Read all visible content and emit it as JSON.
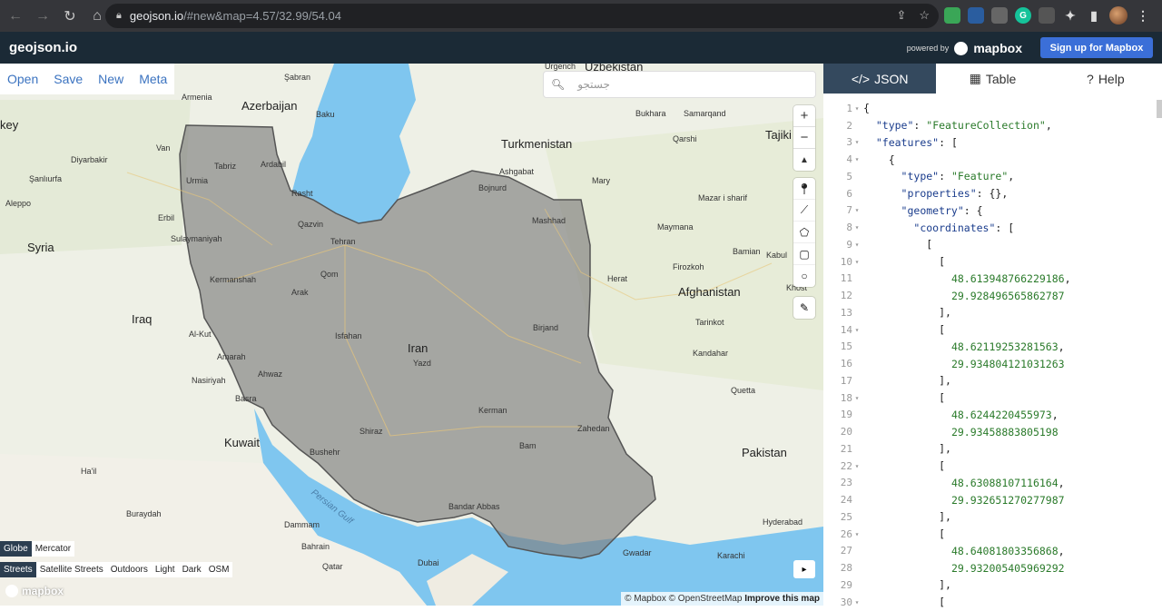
{
  "browser": {
    "url_host": "geojson.io",
    "url_path": "/#new&map=4.57/32.99/54.04"
  },
  "app": {
    "brand": "geojson.io",
    "powered_by": "powered by",
    "mapbox": "mapbox",
    "signup": "Sign up for Mapbox"
  },
  "menu": {
    "open": "Open",
    "save": "Save",
    "new": "New",
    "meta": "Meta"
  },
  "search": {
    "placeholder": "جستجو"
  },
  "map_labels": {
    "countries": [
      "Turkmenistan",
      "Afghanistan",
      "Iraq",
      "Syria",
      "Iran",
      "Pakistan",
      "Kuwait",
      "Uzbekistan",
      "Tajiki",
      "Azerbaijan"
    ],
    "cities": [
      "Şabran",
      "Baku",
      "Armenia",
      "key",
      "Van",
      "Diyarbakir",
      "Şanlıurfa",
      "Aleppo",
      "Erbil",
      "Sulaymaniyah",
      "Tabriz",
      "Ardabil",
      "Urmia",
      "Rasht",
      "Qazvin",
      "Tehran",
      "Qom",
      "Arak",
      "Kermanshah",
      "Isfahan",
      "Yazd",
      "Al-Kut",
      "Amarah",
      "Nasiriyah",
      "Ahwaz",
      "Basra",
      "Shiraz",
      "Kerman",
      "Bam",
      "Zahedan",
      "Bushehr",
      "Bandar Abbas",
      "Ha'il",
      "Buraydah",
      "Dammam",
      "Bahrain",
      "Qatar",
      "Dubai",
      "Gwadar",
      "Karachi",
      "Hyderabad",
      "Quetta",
      "Kandahar",
      "Herat",
      "Mashhad",
      "Bojnurd",
      "Ashgabat",
      "Mary",
      "Birjand",
      "Bukhara",
      "Samarqand",
      "Qarshi",
      "Mazar i sharif",
      "Maymana",
      "Bamian",
      "Kabul",
      "Firozkoh",
      "Tarinkot",
      "Khost",
      "Urgench"
    ],
    "water": "Persian Gulf"
  },
  "map_controls": {
    "zoom_in": "+",
    "zoom_out": "−",
    "compass": "▲"
  },
  "projections": {
    "globe": "Globe",
    "mercator": "Mercator"
  },
  "styles": [
    "Streets",
    "Satellite Streets",
    "Outdoors",
    "Light",
    "Dark",
    "OSM"
  ],
  "attribution": {
    "mapbox": "© Mapbox",
    "osm": "© OpenStreetMap",
    "improve": "Improve this map"
  },
  "panel": {
    "tabs": [
      "JSON",
      "Table",
      "Help"
    ],
    "lines": [
      {
        "n": "1",
        "fold": "▾",
        "t": "{"
      },
      {
        "n": "2",
        "fold": "",
        "t": "  \"type\": \"FeatureCollection\","
      },
      {
        "n": "3",
        "fold": "▾",
        "t": "  \"features\": ["
      },
      {
        "n": "4",
        "fold": "▾",
        "t": "    {"
      },
      {
        "n": "5",
        "fold": "",
        "t": "      \"type\": \"Feature\","
      },
      {
        "n": "6",
        "fold": "",
        "t": "      \"properties\": {},"
      },
      {
        "n": "7",
        "fold": "▾",
        "t": "      \"geometry\": {"
      },
      {
        "n": "8",
        "fold": "▾",
        "t": "        \"coordinates\": ["
      },
      {
        "n": "9",
        "fold": "▾",
        "t": "          ["
      },
      {
        "n": "10",
        "fold": "▾",
        "t": "            ["
      },
      {
        "n": "11",
        "fold": "",
        "t": "              48.613948766229186,"
      },
      {
        "n": "12",
        "fold": "",
        "t": "              29.928496565862787"
      },
      {
        "n": "13",
        "fold": "",
        "t": "            ],"
      },
      {
        "n": "14",
        "fold": "▾",
        "t": "            ["
      },
      {
        "n": "15",
        "fold": "",
        "t": "              48.62119253281563,"
      },
      {
        "n": "16",
        "fold": "",
        "t": "              29.934804121031263"
      },
      {
        "n": "17",
        "fold": "",
        "t": "            ],"
      },
      {
        "n": "18",
        "fold": "▾",
        "t": "            ["
      },
      {
        "n": "19",
        "fold": "",
        "t": "              48.6244220455973,"
      },
      {
        "n": "20",
        "fold": "",
        "t": "              29.93458883805198"
      },
      {
        "n": "21",
        "fold": "",
        "t": "            ],"
      },
      {
        "n": "22",
        "fold": "▾",
        "t": "            ["
      },
      {
        "n": "23",
        "fold": "",
        "t": "              48.63088107116164,"
      },
      {
        "n": "24",
        "fold": "",
        "t": "              29.932651270277987"
      },
      {
        "n": "25",
        "fold": "",
        "t": "            ],"
      },
      {
        "n": "26",
        "fold": "▾",
        "t": "            ["
      },
      {
        "n": "27",
        "fold": "",
        "t": "              48.64081803356868,"
      },
      {
        "n": "28",
        "fold": "",
        "t": "              29.932005405969292"
      },
      {
        "n": "29",
        "fold": "",
        "t": "            ],"
      },
      {
        "n": "30",
        "fold": "▾",
        "t": "            ["
      }
    ]
  },
  "colors": {
    "chrome": "#35363a",
    "appbar": "#1b2a36",
    "signup": "#3b6fd8",
    "active_tab": "#34495e",
    "polygon_fill": "#7e7e7e",
    "water": "#7fc6ef"
  }
}
